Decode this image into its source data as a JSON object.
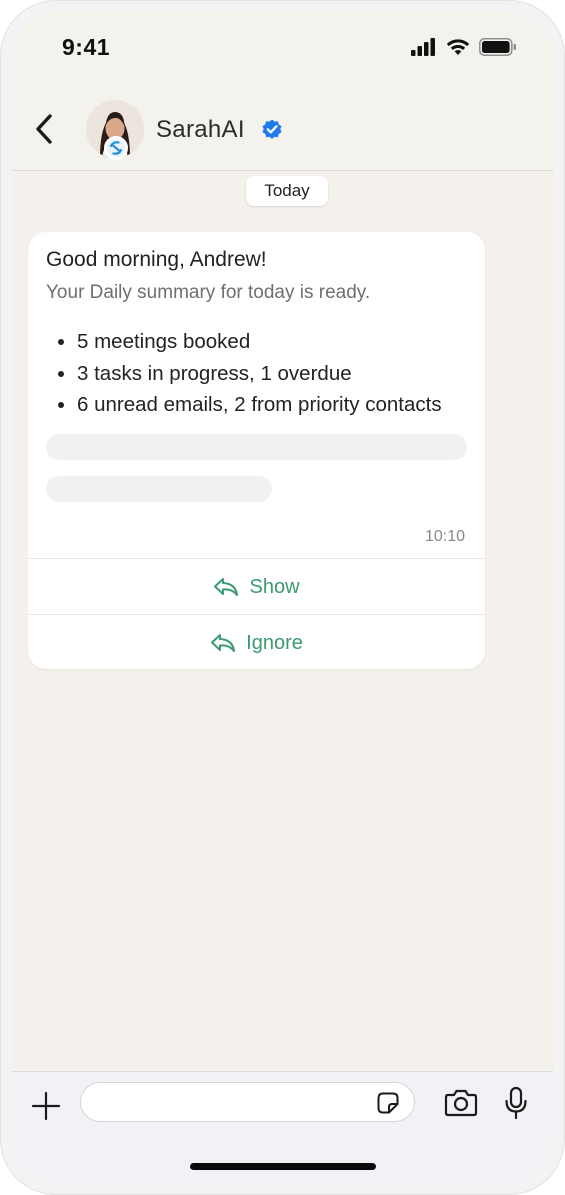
{
  "status_bar": {
    "time": "9:41"
  },
  "header": {
    "contact_name": "SarahAI",
    "verified": true
  },
  "chat": {
    "date_label": "Today",
    "message": {
      "greeting": "Good morning, Andrew!",
      "subtitle": "Your Daily summary for today is ready.",
      "items": [
        "5 meetings booked",
        "3 tasks in progress, 1 overdue",
        "6 unread emails, 2 from priority contacts"
      ],
      "time": "10:10",
      "actions": {
        "show_label": "Show",
        "ignore_label": "Ignore"
      }
    }
  },
  "composer": {
    "placeholder": ""
  },
  "colors": {
    "accent_green": "#3d9a72",
    "verified_blue": "#1f7aeb",
    "chat_background": "#f4f1ec"
  },
  "icons": [
    "back-chevron-icon",
    "verified-badge-icon",
    "reply-icon",
    "plus-icon",
    "sticker-icon",
    "camera-icon",
    "microphone-icon",
    "signal-icon",
    "wifi-icon",
    "battery-icon"
  ]
}
